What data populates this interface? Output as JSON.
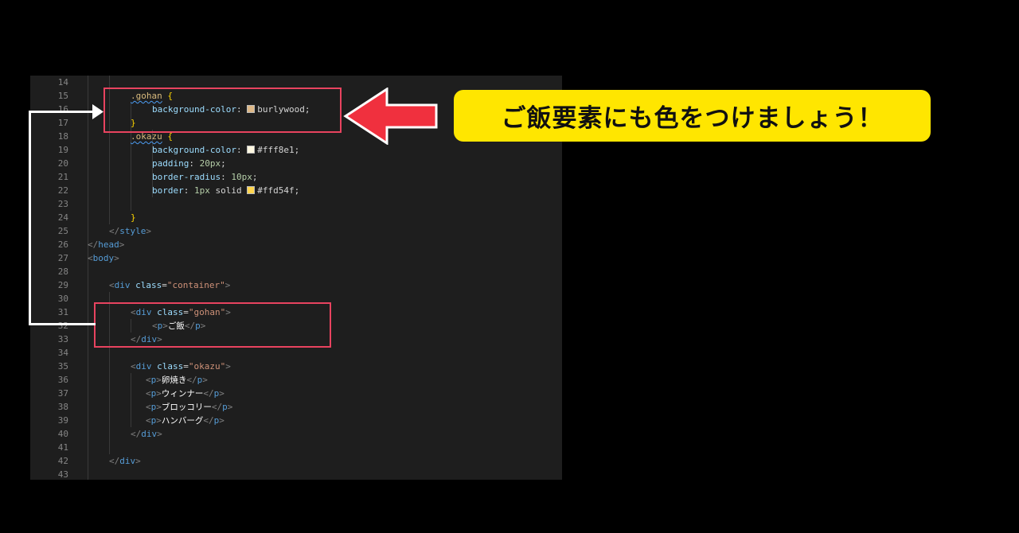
{
  "editor": {
    "line_numbers": [
      "14",
      "15",
      "16",
      "17",
      "18",
      "19",
      "20",
      "21",
      "22",
      "23",
      "24",
      "25",
      "26",
      "27",
      "28",
      "29",
      "30",
      "31",
      "32",
      "33",
      "34",
      "35",
      "36",
      "37",
      "38",
      "39",
      "40",
      "41",
      "42",
      "43"
    ],
    "code": {
      "l15_sel": ".gohan",
      "l15_brace": "{",
      "l16_prop": "background-color",
      "l16_val": "burlywood",
      "l17_brace": "}",
      "l18_sel": ".okazu",
      "l18_brace": "{",
      "l19_prop": "background-color",
      "l19_val": "#fff8e1",
      "l20_prop": "padding",
      "l20_val": "20px",
      "l21_prop": "border-radius",
      "l21_val": "10px",
      "l22_prop": "border",
      "l22_num": "1px",
      "l22_kw": "solid",
      "l22_val": "#ffd54f",
      "l24_brace": "}",
      "l25": "style",
      "l26": "head",
      "l27": "body",
      "l29_tag": "div",
      "l29_attr": "class",
      "l29_str": "\"container\"",
      "l31_tag": "div",
      "l31_attr": "class",
      "l31_str": "\"gohan\"",
      "l32_tag": "p",
      "l32_text": "ご飯",
      "l33_tag": "div",
      "l35_tag": "div",
      "l35_attr": "class",
      "l35_str": "\"okazu\"",
      "l36_text": "卵焼き",
      "l37_text": "ウィンナー",
      "l38_text": "ブロッコリー",
      "l39_text": "ハンバーグ",
      "l40_tag": "div",
      "l42_tag": "div"
    },
    "colors": {
      "burlywood": "#deb887",
      "fff8e1": "#fff8e1",
      "ffd54f": "#ffd54f",
      "highlight": "#e8435f",
      "callout": "#ffe600"
    }
  },
  "callout": {
    "text": "ご飯要素にも色をつけましょう！"
  }
}
